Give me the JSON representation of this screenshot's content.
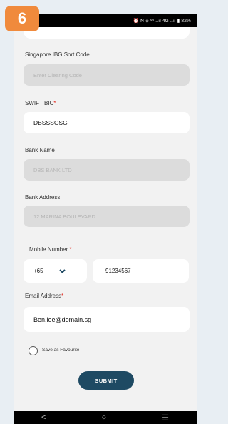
{
  "step_badge": "6",
  "status_bar": {
    "text": "⏰ N ◈ ᵛᵒ ..ıl 4G ..ıl ▮ 82%"
  },
  "form": {
    "ibg_label": "Singapore IBG Sort Code",
    "ibg_placeholder": "Enter Clearing Code",
    "swift_label": "SWIFT BIC",
    "swift_required": "*",
    "swift_value": "DBSSSGSG",
    "bank_name_label": "Bank Name",
    "bank_name_value": "DBS BANK LTD",
    "bank_address_label": "Bank Address",
    "bank_address_value": "12 MARINA BOULEVARD",
    "mobile_label": "Mobile Number",
    "mobile_required": "*",
    "mobile_code": "+65",
    "mobile_value": "91234567",
    "email_label": "Email Address",
    "email_required": "*",
    "email_value": "Ben.lee@domain.sg",
    "favourite_label": "Save as Favourite",
    "submit_label": "SUBMIT"
  },
  "nav": {
    "back": "<",
    "home": "○",
    "recents": "☰"
  },
  "colors": {
    "accent": "#1e4a63",
    "badge": "#f08a3c",
    "required": "#e1261c",
    "disabled_field": "#dcdcdc"
  }
}
